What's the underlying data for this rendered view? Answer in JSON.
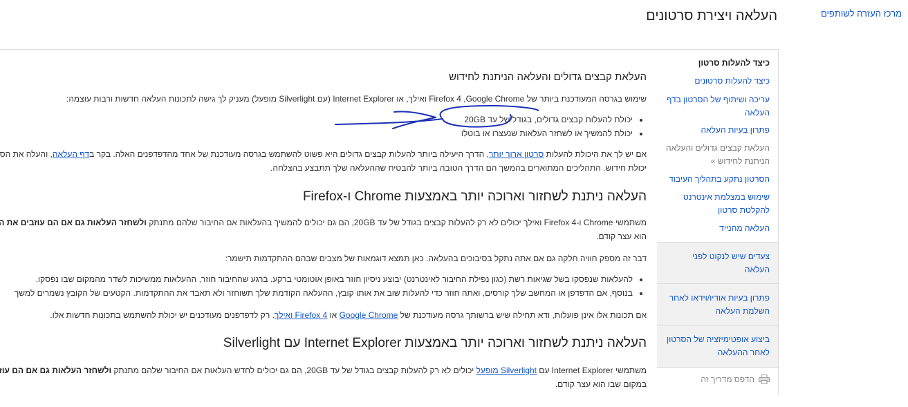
{
  "header": {
    "help_center_link": "מרכז העזרה לשותפים",
    "page_title": "העלאה ויצירת סרטונים"
  },
  "sidebar": {
    "heading": "כיצד להעלות סרטון",
    "items": [
      "כיצד להעלות סרטונים",
      "עריכה ושיתוף של הסרטון בדף העלאה",
      "פתרון בעיות העלאה",
      "העלאת קבצים גדולים והעלאה הניתנת לחידוש »",
      "הסרטון נתקע בתהליך העיבוד",
      "שימוש במצלמת אינטרנט להקלטת סרטון",
      "העלאה מהנייד"
    ],
    "active_index": 3,
    "boxes": [
      "צעדים שיש לנקוט לפני העלאה",
      "פתרון בעיות אודיו/וידאו לאחר השלמת העלאה",
      "ביצוע אופטימיזציה של הסרטון לאחר ההעלאה"
    ],
    "print_label": "הדפס מדריך זה",
    "print_icon": "printer-icon"
  },
  "main": {
    "section1": {
      "heading": "העלאת קבצים גדולים והעלאה הניתנת לחידוש",
      "intro": "שימוש בגרסה המעודכנת ביותר של Google Chrome, ‏Firefox 4 ואילך, או Internet Explorer (עם Silverlight מופעל) מעניק לך גישה לתכונות העלאה חדשות ורבות עוצמה:",
      "bullets": [
        "יכולת להעלות קבצים גדולים, בגודל של עד 20GB",
        "יכולת להמשיך או לשחזר העלאות שנעצרו או בוטלו"
      ],
      "para_a": "אם יש לך את היכולת להעלות ",
      "para_link1": "סרטון ארוך יותר",
      "para_b": ", הדרך היעילה ביותר להעלות קבצים גדולים היא פשוט להשתמש בגרסה מעודכנת של אחד מהדפדפנים האלה. בקר ב",
      "para_link2": "דף העלאה",
      "para_c": ", והעלה את הסרטון כרגיל.",
      "para_line2": "יכולת חידוש. התהליכים המתוארים בהמשך הם הדרך הטובה ביותר להבטיח שההעלאה שלך תתבצע בהצלחה."
    },
    "section2": {
      "heading": "העלאה ניתנת לשחזור וארוכה יותר באמצעות Chrome ו-Firefox",
      "para1_a": "משתמשי Chrome ו-Firefox 4 ואילך יכולים לא רק להעלות קבצים בגודל של עד 20GB, הם גם יכולים להמשיך בהעלאות אם החיבור שלהם מתנתק ",
      "para1_bold": "ולשחזר העלאות גם אם הם עוזבים את הדף",
      "para1_line2": "הוא עצר קודם.",
      "para2": "דבר זה מספק חוויה חלקה גם אם אתה נתקל בסיבוכים בהעלאה. כאן תמצא דוגמאות של מצבים שבהם ההתקדמות תישמר:",
      "bullets": [
        "להעלאות שנפסקו בשל שגיאות רשת (כגון נפילת החיבור לאינטרנט) יבוצע ניסיון חוזר באופן אוטומטי ברקע. ברגע שהחיבור חוזר, ההעלאות ממשיכות לשדר מהמקום שבו נפסקו.",
        "בנוסף, אם הדפדפן או המחשב שלך קורסים, ואתה חוזר כדי להעלות שוב את אותו קובץ, ההעלאה הקודמת שלך תשוחזר ולא תאבד את ההתקדמות. הקטעים של הקובץ נשמרים למשך"
      ],
      "para3_a": "אם תכונות אלו אינן פועלות, ודא תחילה שיש ברשותך גרסה מעודכנת של ",
      "para3_link1": "Google Chrome",
      "para3_mid": " או ",
      "para3_link2": "Firefox 4 ואילך",
      "para3_b": ". רק לדפדפנים מעודכנים יש יכולת להשתמש בתכונות חדשות אלו."
    },
    "section3": {
      "heading": "העלאה ניתנת לשחזור וארוכה יותר באמצעות Internet Explorer עם Silverlight",
      "para1_a": "משתמשי Internet Explorer עם ",
      "para1_link": "Silverlight מופעל",
      "para1_b": " יכולים לא רק להעלות קבצים בגודל של עד 20GB, הם גם יכולים לחדש העלאות אם החיבור שלהם מתנתק ",
      "para1_bold": "ולשחזר העלאות גם אם הם עוזבים את הדף",
      "para1_line2": "במקום שבו הוא עצר קודם."
    }
  },
  "colors": {
    "link": "#1155cc",
    "scribble": "#1a2fb5",
    "sidebar_box": "#f1f1f1"
  }
}
